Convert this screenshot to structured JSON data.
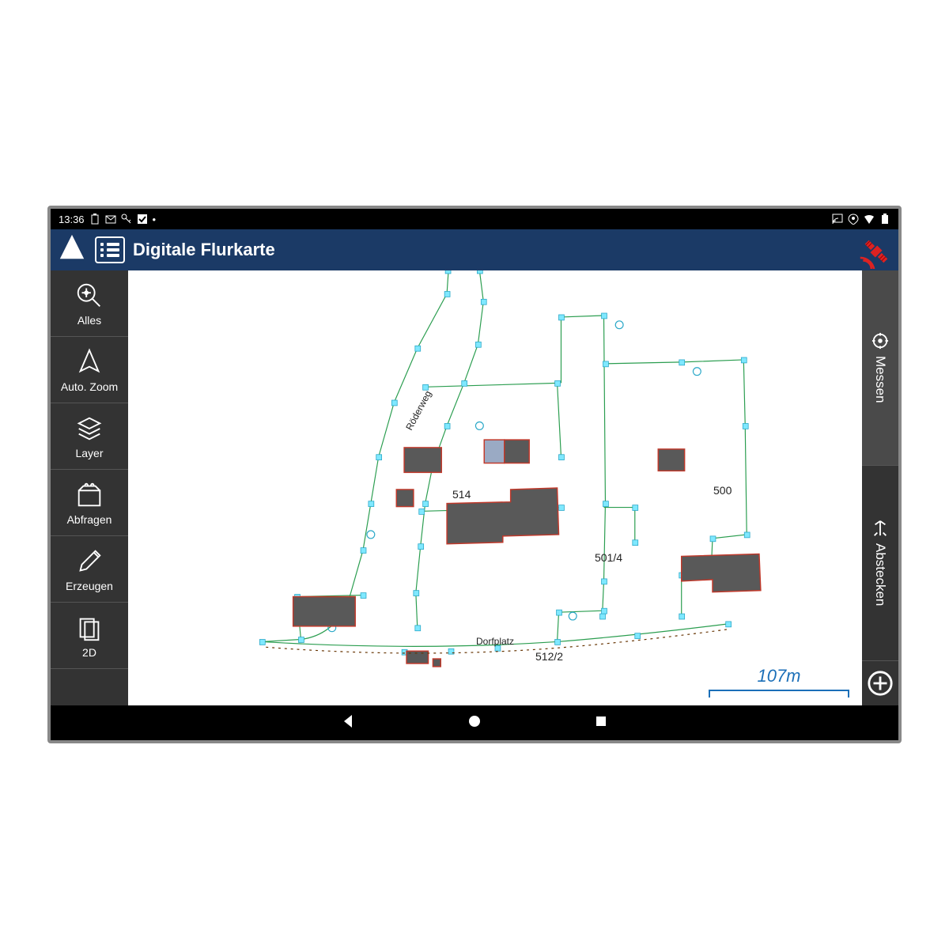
{
  "statusbar": {
    "time": "13:36"
  },
  "header": {
    "title": "Digitale Flurkarte"
  },
  "leftbar": {
    "alles": "Alles",
    "autozoom": "Auto. Zoom",
    "layer": "Layer",
    "abfragen": "Abfragen",
    "erzeugen": "Erzeugen",
    "twod": "2D"
  },
  "rightbar": {
    "messen": "Messen",
    "abstecken": "Abstecken"
  },
  "map": {
    "scale": "107m",
    "labels": {
      "parcel_514": "514",
      "parcel_500": "500",
      "parcel_501_4": "501/4",
      "parcel_512_2": "512/2",
      "street_roederweg": "Röderweg",
      "street_dorfplatz": "Dorfplatz"
    }
  }
}
